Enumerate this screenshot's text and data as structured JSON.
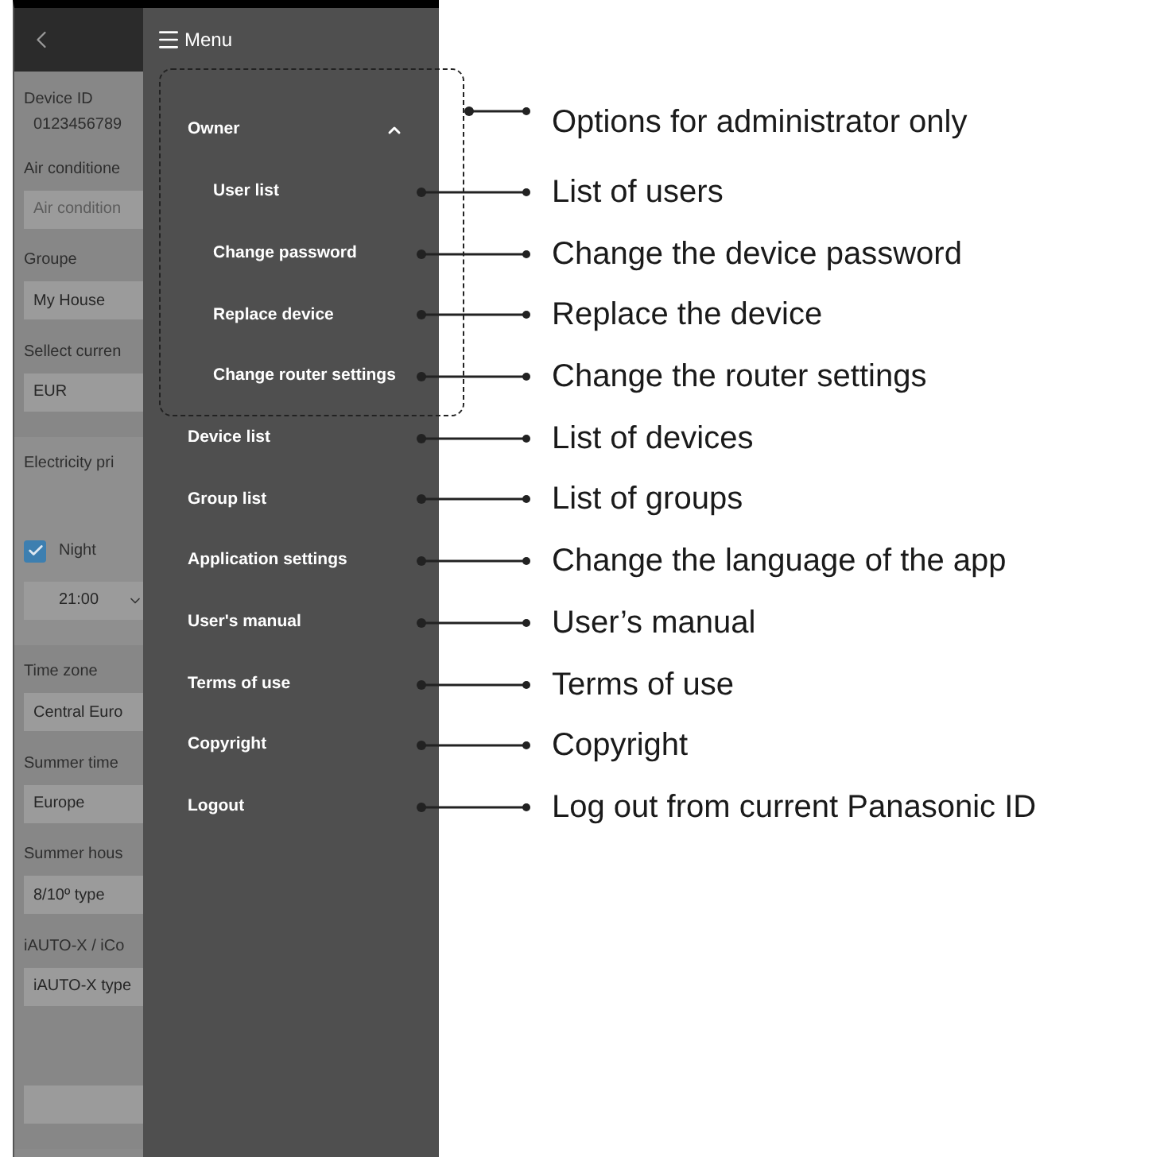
{
  "background_form": {
    "sections": [
      {
        "items": [
          {
            "kind": "label",
            "text": "Device ID"
          },
          {
            "kind": "value",
            "text": "0123456789"
          },
          {
            "kind": "label",
            "text": "Air conditione"
          },
          {
            "kind": "field",
            "placeholder": "Air condition"
          },
          {
            "kind": "label",
            "text": "Groupe"
          },
          {
            "kind": "field",
            "value": "My House"
          },
          {
            "kind": "label",
            "text": "Sellect curren"
          },
          {
            "kind": "field",
            "value": "EUR"
          }
        ]
      },
      {
        "items": [
          {
            "kind": "label",
            "text": "Electricity pri"
          },
          {
            "kind": "checkbox",
            "text": "Night",
            "checked": true
          },
          {
            "kind": "dropdown",
            "value": "21:00"
          }
        ]
      },
      {
        "items": [
          {
            "kind": "label",
            "text": "Time zone"
          },
          {
            "kind": "field",
            "value": "Central Euro"
          },
          {
            "kind": "label",
            "text": "Summer time"
          },
          {
            "kind": "field",
            "value": "Europe"
          },
          {
            "kind": "label",
            "text": "Summer hous"
          },
          {
            "kind": "field",
            "value": "8/10º type"
          },
          {
            "kind": "label",
            "text": "iAUTO-X / iCo"
          },
          {
            "kind": "field",
            "value": "iAUTO-X type"
          },
          {
            "kind": "button"
          }
        ]
      }
    ]
  },
  "menu": {
    "title": "Menu",
    "items": [
      {
        "label": "Owner",
        "expanded": true,
        "children": [
          {
            "label": "User list"
          },
          {
            "label": "Change password"
          },
          {
            "label": "Replace device"
          },
          {
            "label": "Change router settings"
          }
        ]
      },
      {
        "label": "Device list"
      },
      {
        "label": "Group list"
      },
      {
        "label": "Application settings"
      },
      {
        "label": "User's manual"
      },
      {
        "label": "Terms of use"
      },
      {
        "label": "Copyright"
      },
      {
        "label": "Logout"
      }
    ]
  },
  "callouts": [
    {
      "kind": "bracket",
      "text": "Options for administrator only"
    },
    {
      "kind": "item",
      "text": "List of users"
    },
    {
      "kind": "item",
      "text": "Change the device password"
    },
    {
      "kind": "item",
      "text": "Replace the device"
    },
    {
      "kind": "item",
      "text": "Change the router settings"
    },
    {
      "kind": "item",
      "text": "List of devices"
    },
    {
      "kind": "item",
      "text": "List of groups"
    },
    {
      "kind": "item",
      "text": "Change the language of the app"
    },
    {
      "kind": "item",
      "text": "User’s manual"
    },
    {
      "kind": "item",
      "text": "Terms of use"
    },
    {
      "kind": "item",
      "text": "Copyright"
    },
    {
      "kind": "item",
      "text": "Log out from current Panasonic ID"
    }
  ]
}
